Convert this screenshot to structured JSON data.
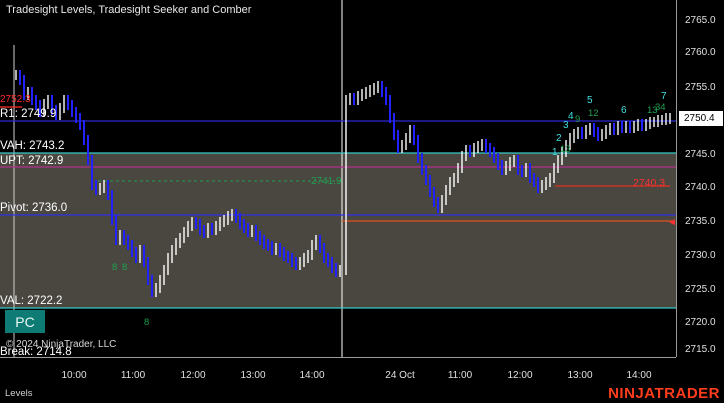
{
  "title": "Tradesight Levels, Tradesight Seeker and Comber",
  "levels": [
    {
      "label": "2752.3",
      "color": "#ff2a2a"
    },
    {
      "label": "R1: 2749.9",
      "color": "#ffffff"
    },
    {
      "label": "VAH: 2743.2",
      "color": "#ffffff"
    },
    {
      "label": "UPT: 2742.9",
      "color": "#ffffff"
    },
    {
      "label": "Pivot: 2736.0",
      "color": "#ffffff"
    },
    {
      "label": "VAL: 2722.2",
      "color": "#ffffff"
    },
    {
      "label": "Break: 2714.8",
      "color": "#ffffff"
    }
  ],
  "pc_button": "PC",
  "copyright": "© 2024 NinjaTrader, LLC",
  "price_axis": {
    "ticks": [
      "2765.0",
      "2760.0",
      "2755.0",
      "2750.0",
      "2745.0",
      "2740.0",
      "2735.0",
      "2730.0",
      "2725.0",
      "2720.0",
      "2715.0"
    ],
    "current_price": "2750.4"
  },
  "time_axis": {
    "ticks": [
      "10:00",
      "11:00",
      "12:00",
      "13:00",
      "14:00",
      "24 Oct",
      "11:00",
      "12:00",
      "13:00",
      "14:00"
    ]
  },
  "annotations": {
    "seeker_counts_cyan": [
      "1",
      "2",
      "3",
      "4",
      "5",
      "6",
      "7"
    ],
    "seeker_counts_green": [
      "8",
      "8",
      "8",
      "9",
      "12",
      "13",
      "13",
      "34"
    ],
    "session2_level_value": "2740.3",
    "session1_green_value": "2741.9"
  },
  "footer": {
    "panel_label": "Levels",
    "brand": "NINJATRADER"
  },
  "colors": {
    "background": "#000000",
    "value_area": "#4a4740",
    "bar_up": "#ffffff",
    "bar_down": "#2222ff",
    "r1_line": "#2a2ad0",
    "vah_line": "#36c8c8",
    "upt_line": "#b0308a",
    "pivot_line": "#3030e0",
    "red_line": "#e03020",
    "seeker_cyan": "#40e0e0",
    "seeker_green": "#20a050",
    "brand": "#ff3c1c"
  }
}
